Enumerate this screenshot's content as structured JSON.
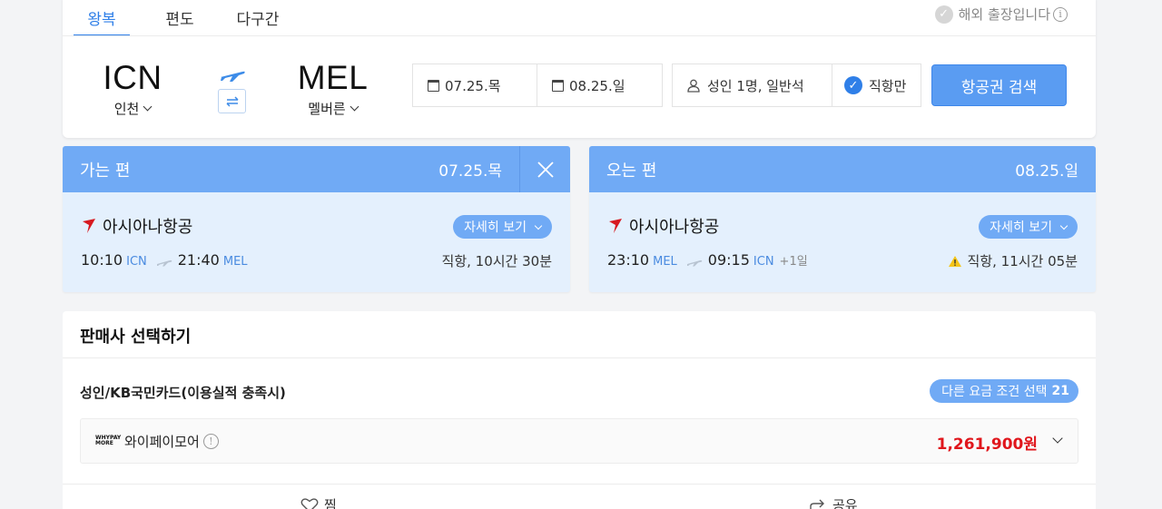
{
  "tabs": [
    {
      "label": "왕복",
      "active": true
    },
    {
      "label": "편도",
      "active": false
    },
    {
      "label": "다구간",
      "active": false
    }
  ],
  "overseas_trip": {
    "label": "해외 출장입니다",
    "checked": false
  },
  "origin": {
    "code": "ICN",
    "city": "인천"
  },
  "destination": {
    "code": "MEL",
    "city": "멜버른"
  },
  "dates": {
    "depart": "07.25.목",
    "return": "08.25.일"
  },
  "passengers": {
    "label": "성인 1명, 일반석"
  },
  "direct_only": {
    "label": "직항만",
    "checked": true
  },
  "search_button": {
    "label": "항공권 검색"
  },
  "outbound": {
    "header": "가는 편",
    "date": "07.25.목",
    "airline": "아시아나항공",
    "detail_label": "자세히 보기",
    "depart_time": "10:10",
    "depart_airport": "ICN",
    "arrive_time": "21:40",
    "arrive_airport": "MEL",
    "duration": "직항, 10시간 30분"
  },
  "inbound": {
    "header": "오는 편",
    "date": "08.25.일",
    "airline": "아시아나항공",
    "detail_label": "자세히 보기",
    "depart_time": "23:10",
    "depart_airport": "MEL",
    "arrive_time": "09:15",
    "arrive_airport": "ICN",
    "plus_day": "+1일",
    "duration": "직항, 11시간 05분"
  },
  "seller": {
    "title": "판매사 선택하기",
    "fare_condition": "성인/KB국민카드(이용실적 충족시)",
    "other_fare_label": "다른 요금 조건 선택",
    "other_fare_count": "21",
    "vendor": {
      "logo_line1": "WHYPAY",
      "logo_line2": "MORE",
      "name": "와이페이모어",
      "price": "1,261,900원"
    },
    "actions": {
      "save": "찜",
      "share": "공유"
    }
  },
  "colors": {
    "accent": "#2f7fe8",
    "panel_header": "#70aaf5",
    "panel_body": "#e4f0fd",
    "price": "#e0161c"
  }
}
